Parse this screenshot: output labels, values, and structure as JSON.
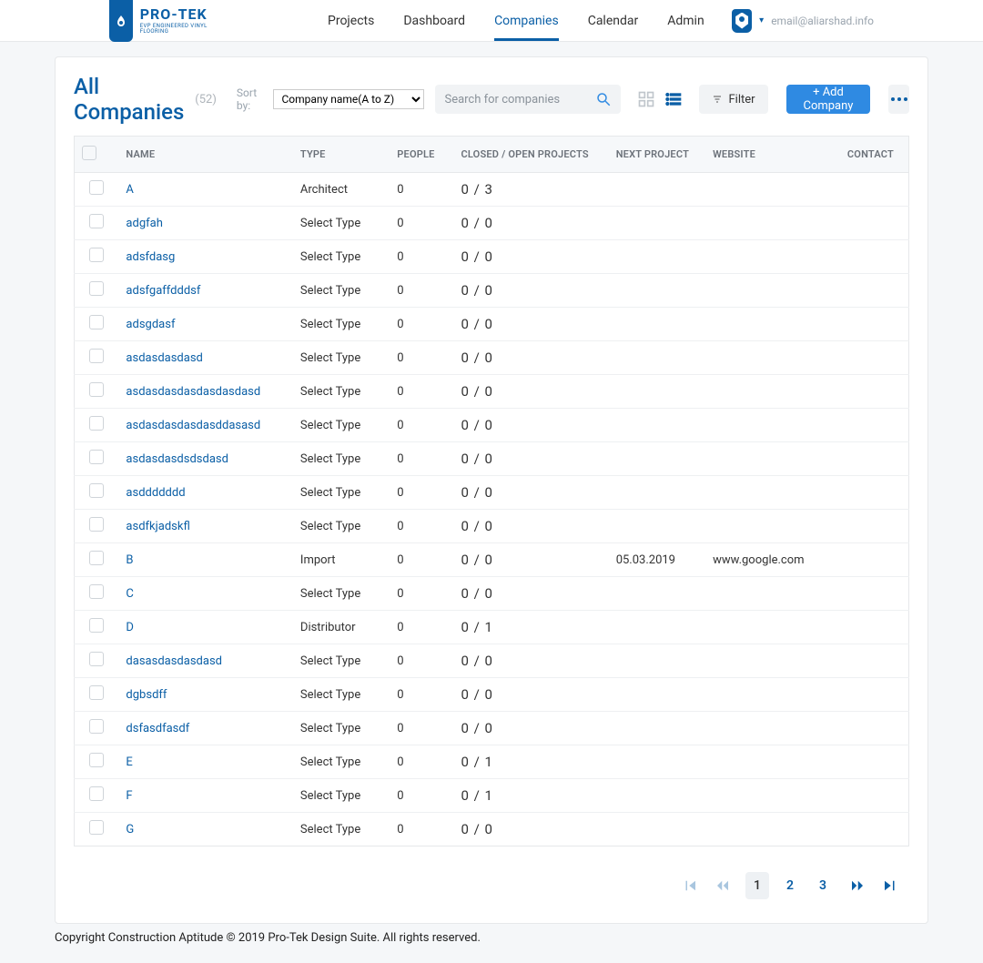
{
  "brand": {
    "name": "PRO-TEK",
    "tagline": "EVP ENGINEERED VINYL FLOORING"
  },
  "nav": {
    "items": [
      "Projects",
      "Dashboard",
      "Companies",
      "Calendar",
      "Admin"
    ],
    "active": "Companies"
  },
  "user": {
    "email": "email@aliarshad.info"
  },
  "page": {
    "title": "All Companies",
    "count": "(52)",
    "sort_label": "Sort by:",
    "sort_value": "Company name(A to Z)"
  },
  "search": {
    "placeholder": "Search for companies"
  },
  "toolbar": {
    "filter": "Filter",
    "add": "+ Add Company"
  },
  "table": {
    "headers": {
      "name": "NAME",
      "type": "TYPE",
      "people": "PEOPLE",
      "projects": "CLOSED / OPEN PROJECTS",
      "next": "NEXT PROJECT",
      "website": "WEBSITE",
      "contact": "CONTACT"
    },
    "rows": [
      {
        "name": "A",
        "type": "Architect",
        "people": "0",
        "projects": "0 / 3",
        "next": "",
        "website": "",
        "contact": ""
      },
      {
        "name": "adgfah",
        "type": "Select Type",
        "people": "0",
        "projects": "0 / 0",
        "next": "",
        "website": "",
        "contact": ""
      },
      {
        "name": "adsfdasg",
        "type": "Select Type",
        "people": "0",
        "projects": "0 / 0",
        "next": "",
        "website": "",
        "contact": ""
      },
      {
        "name": "adsfgaffdddsf",
        "type": "Select Type",
        "people": "0",
        "projects": "0 / 0",
        "next": "",
        "website": "",
        "contact": ""
      },
      {
        "name": "adsgdasf",
        "type": "Select Type",
        "people": "0",
        "projects": "0 / 0",
        "next": "",
        "website": "",
        "contact": ""
      },
      {
        "name": "asdasdasdasd",
        "type": "Select Type",
        "people": "0",
        "projects": "0 / 0",
        "next": "",
        "website": "",
        "contact": ""
      },
      {
        "name": "asdasdasdasdasdasdasd",
        "type": "Select Type",
        "people": "0",
        "projects": "0 / 0",
        "next": "",
        "website": "",
        "contact": ""
      },
      {
        "name": "asdasdasdasdasddasasd",
        "type": "Select Type",
        "people": "0",
        "projects": "0 / 0",
        "next": "",
        "website": "",
        "contact": ""
      },
      {
        "name": "asdasdasdsdsdasd",
        "type": "Select Type",
        "people": "0",
        "projects": "0 / 0",
        "next": "",
        "website": "",
        "contact": ""
      },
      {
        "name": "asddddddd",
        "type": "Select Type",
        "people": "0",
        "projects": "0 / 0",
        "next": "",
        "website": "",
        "contact": ""
      },
      {
        "name": "asdfkjadskfl",
        "type": "Select Type",
        "people": "0",
        "projects": "0 / 0",
        "next": "",
        "website": "",
        "contact": ""
      },
      {
        "name": "B",
        "type": "Import",
        "people": "0",
        "projects": "0 / 0",
        "next": "05.03.2019",
        "website": "www.google.com",
        "contact": ""
      },
      {
        "name": "C",
        "type": "Select Type",
        "people": "0",
        "projects": "0 / 0",
        "next": "",
        "website": "",
        "contact": ""
      },
      {
        "name": "D",
        "type": "Distributor",
        "people": "0",
        "projects": "0 / 1",
        "next": "",
        "website": "",
        "contact": ""
      },
      {
        "name": "dasasdasdasdasd",
        "type": "Select Type",
        "people": "0",
        "projects": "0 / 0",
        "next": "",
        "website": "",
        "contact": ""
      },
      {
        "name": "dgbsdff",
        "type": "Select Type",
        "people": "0",
        "projects": "0 / 0",
        "next": "",
        "website": "",
        "contact": ""
      },
      {
        "name": "dsfasdfasdf",
        "type": "Select Type",
        "people": "0",
        "projects": "0 / 0",
        "next": "",
        "website": "",
        "contact": ""
      },
      {
        "name": "E",
        "type": "Select Type",
        "people": "0",
        "projects": "0 / 1",
        "next": "",
        "website": "",
        "contact": ""
      },
      {
        "name": "F",
        "type": "Select Type",
        "people": "0",
        "projects": "0 / 1",
        "next": "",
        "website": "",
        "contact": ""
      },
      {
        "name": "G",
        "type": "Select Type",
        "people": "0",
        "projects": "0 / 0",
        "next": "",
        "website": "",
        "contact": ""
      }
    ]
  },
  "pagination": {
    "pages": [
      "1",
      "2",
      "3"
    ],
    "current": "1"
  },
  "footer": {
    "text": "Copyright Construction Aptitude © 2019 Pro-Tek Design Suite. All rights reserved."
  }
}
